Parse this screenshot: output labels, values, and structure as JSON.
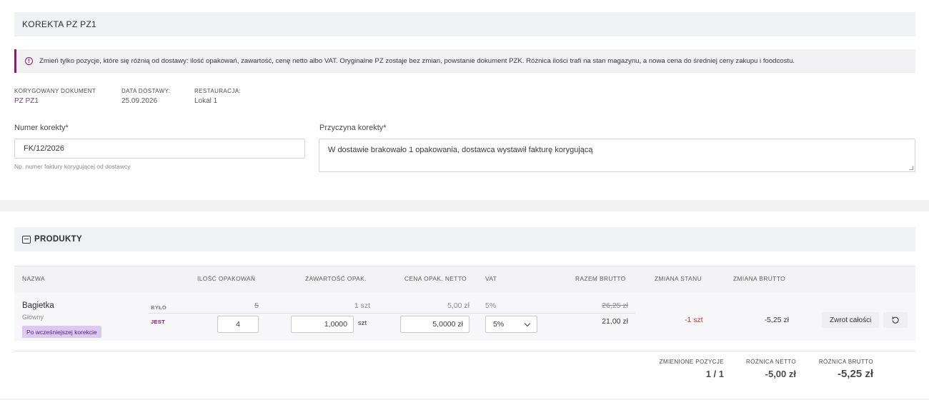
{
  "correction": {
    "title": "KOREKTA PZ PZ1",
    "notice": "Zmień tylko pozycje, które się różnią od dostawy: ilość opakowań, zawartość, cenę netto albo VAT. Oryginalne PZ zostaje bez zmian, powstanie dokument PZK. Różnica ilości trafi na stan magazynu, a nowa cena do średniej ceny zakupu i foodcostu.",
    "meta": [
      {
        "label": "KORYGOWANY DOKUMENT",
        "value": "PZ PZ1"
      },
      {
        "label": "DATA DOSTAWY:",
        "value": "25.09.2026"
      },
      {
        "label": "RESTAURACJA:",
        "value": "Lokal 1"
      }
    ],
    "number_field": {
      "label": "Numer korekty*",
      "value": "FK/12/2026",
      "hint": "Np. numer faktury korygującej od dostawcy"
    },
    "reason_field": {
      "label": "Przyczyna korekty*",
      "value": "W dostawie brakowało 1 opakowania, dostawca wystawił fakturę korygującą"
    }
  },
  "products": {
    "title": "PRODUKTY",
    "columns": {
      "name": "NAZWA",
      "packages": "ILOŚĆ OPAKOWAŃ",
      "content": "ZAWARTOŚĆ OPAK.",
      "net_price": "CENA OPAK. NETTO",
      "vat": "VAT",
      "gross_total": "RAZEM BRUTTO",
      "stock_change": "ZMIANA STANU",
      "gross_change": "ZMIANA BRUTTO"
    },
    "rows": [
      {
        "name": "Bagietka",
        "subtitle": "Główny",
        "badge": "Po wcześniejszej korekcie",
        "was_tag": "BYŁO",
        "now_tag": "JEST",
        "was": {
          "packages": "5",
          "content": "1 szt",
          "net_price": "5,00 zł",
          "vat": "5%",
          "gross_total": "26,25 zł"
        },
        "now": {
          "packages": "4",
          "content": "1,0000",
          "content_unit": "szt",
          "net_price": "5,0000 zł",
          "vat": "5%",
          "gross_total": "21,00 zł"
        },
        "stock_change": "-1 szt",
        "gross_change": "-5,25 zł",
        "return_label": "Zwrot całości",
        "undo_icon": "undo-icon"
      }
    ]
  },
  "summary": {
    "changed_positions": {
      "label": "ZMIENIONE POZYCJE",
      "value": "1 / 1"
    },
    "net_difference": {
      "label": "RÓŻNICA NETTO",
      "value": "-5,00 zł"
    },
    "gross_difference": {
      "label": "RÓŻNICA BRUTTO",
      "value": "-5,25 zł"
    }
  },
  "colors": {
    "accent": "#8b1a6b",
    "link": "#6b3fa0",
    "negative": "#c0392b",
    "badge": "#dcc8f0"
  }
}
